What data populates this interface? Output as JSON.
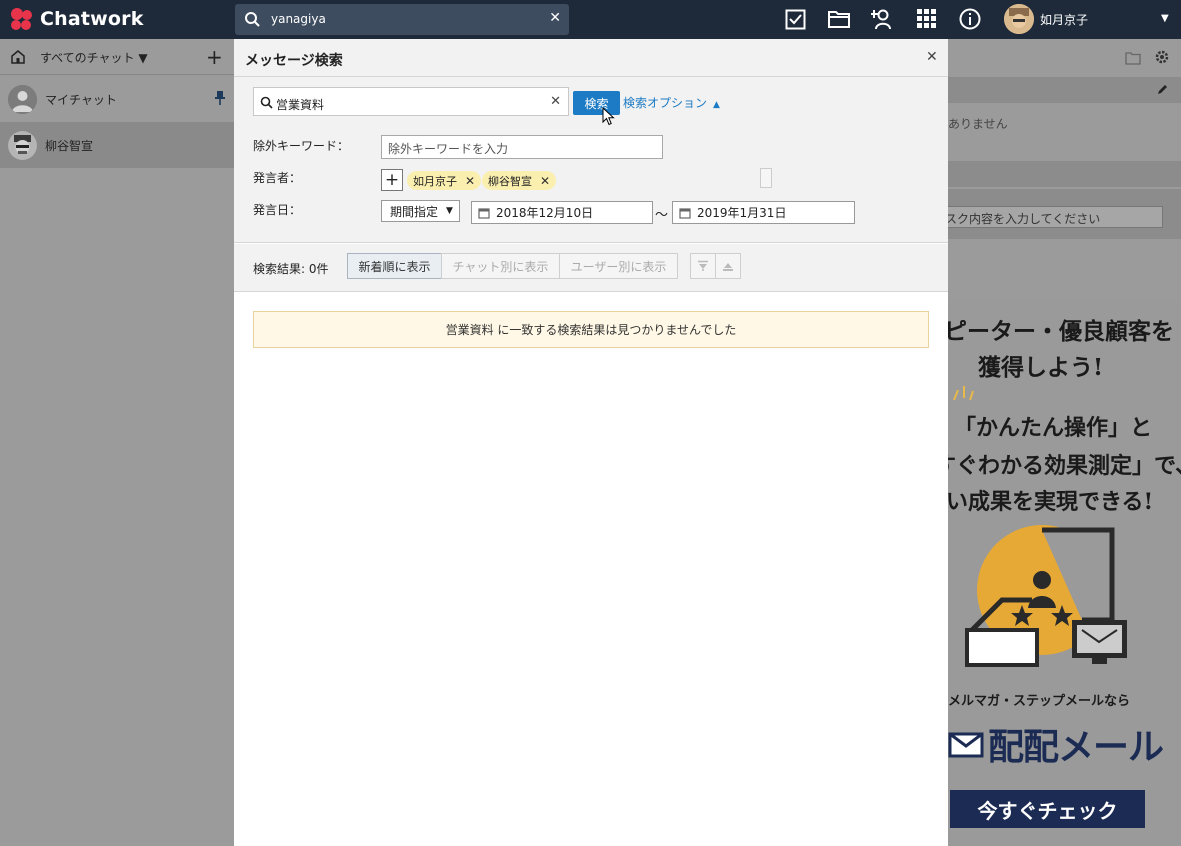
{
  "topbar": {
    "app_name": "Chatwork",
    "search_value": "yanagiya",
    "user_name": "如月京子"
  },
  "sidebar": {
    "filter_label": "すべてのチャット ▼",
    "chats": [
      {
        "name": "マイチャット"
      },
      {
        "name": "柳谷智宣"
      }
    ]
  },
  "right_pane": {
    "partial_empty_text": "ありません",
    "partial_task_placeholder": "スク内容を入力してください"
  },
  "ad": {
    "lines": [
      "ピーター・優良顧客を",
      "獲得しよう!",
      "「かんたん操作」と",
      "すぐわかる効果測定」で、",
      "い成果を実現できる!",
      "メルマガ・ステップメールなら",
      "配配メール"
    ],
    "cta": "今すぐチェック"
  },
  "modal": {
    "title": "メッセージ検索",
    "keyword": "営業資料",
    "search_button": "検索",
    "options_link": "検索オプション",
    "exclude_label": "除外キーワード：",
    "exclude_placeholder": "除外キーワードを入力",
    "speaker_label": "発言者：",
    "speakers": [
      "如月京子",
      "柳谷智宣"
    ],
    "date_label": "発言日：",
    "period_select": "期間指定",
    "date_from": "2018年12月10日",
    "date_to": "2019年1月31日",
    "date_separator": "～",
    "result_count": "検索結果: 0件",
    "tabs": [
      "新着順に表示",
      "チャット別に表示",
      "ユーザー別に表示"
    ],
    "no_result_message": "営業資料 に一致する検索結果は見つかりませんでした"
  }
}
